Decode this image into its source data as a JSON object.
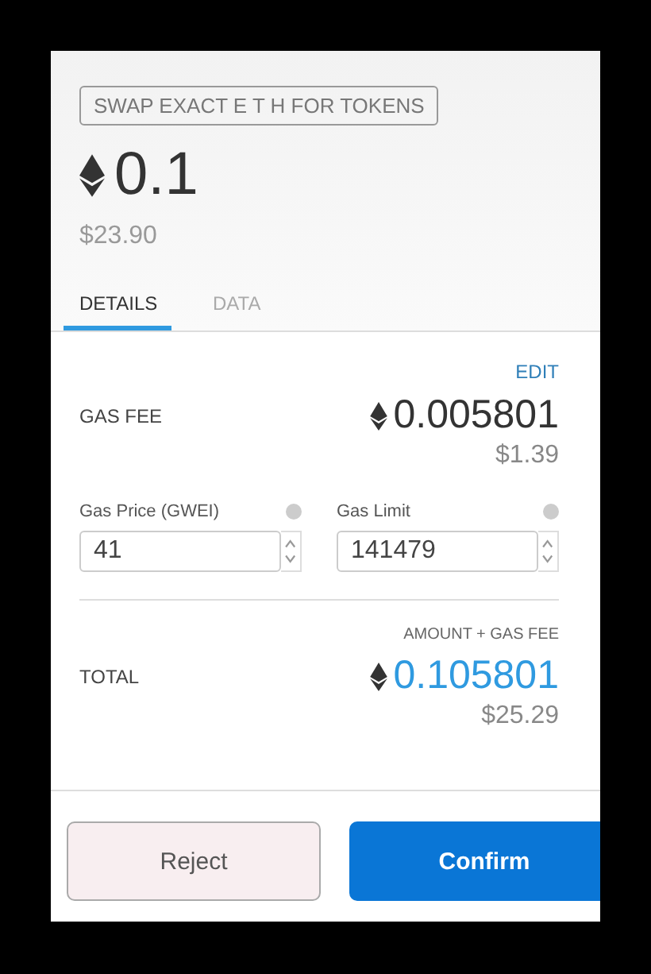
{
  "action_label": "SWAP EXACT E T H FOR TOKENS",
  "amount": "0.1",
  "amount_fiat": "$23.90",
  "tabs": [
    {
      "label": "DETAILS",
      "selected": true
    },
    {
      "label": "DATA",
      "selected": false
    }
  ],
  "edit": "EDIT",
  "gas_fee": {
    "label": "GAS FEE",
    "value": "0.005801",
    "fiat": "$1.39"
  },
  "inputs": [
    {
      "label": "Gas Price (GWEI)",
      "value": "41"
    },
    {
      "label": "Gas Limit",
      "value": "141479"
    }
  ],
  "total": {
    "caption": "AMOUNT + GAS FEE",
    "label": "TOTAL",
    "value": "0.105801",
    "fiat": "$25.29"
  },
  "buttons": [
    {
      "label": "Reject",
      "kind": "secondary"
    },
    {
      "label": "Confirm",
      "kind": "primary"
    }
  ]
}
